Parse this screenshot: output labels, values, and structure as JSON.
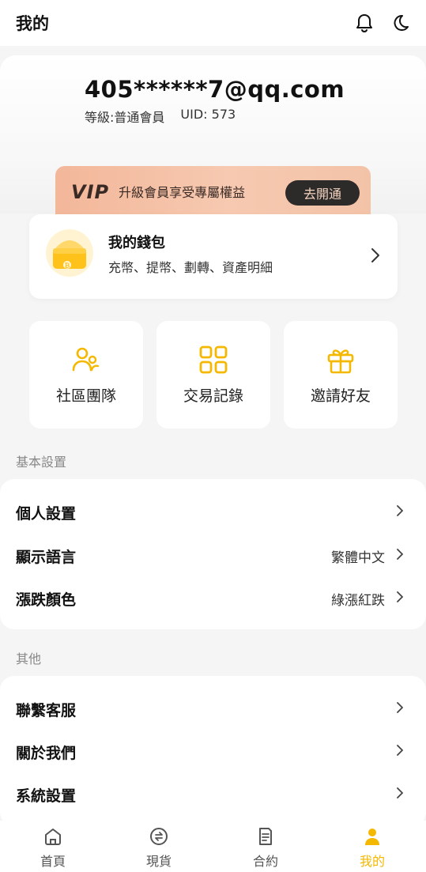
{
  "header": {
    "title": "我的",
    "icons": [
      "bell-icon",
      "moon-icon"
    ]
  },
  "profile": {
    "email": "405******7@qq.com",
    "level_label": "等級:普通會員",
    "uid": "UID: 573"
  },
  "vip": {
    "logo": "VIP",
    "text": "升級會員享受專屬權益",
    "button": "去開通"
  },
  "wallet": {
    "title": "我的錢包",
    "subtitle": "充幣、提幣、劃轉、資產明細"
  },
  "quick_actions": [
    {
      "label": "社區團隊",
      "icon": "team-icon"
    },
    {
      "label": "交易記錄",
      "icon": "grid-icon"
    },
    {
      "label": "邀請好友",
      "icon": "gift-icon"
    }
  ],
  "basic_settings": {
    "title": "基本設置",
    "rows": [
      {
        "label": "個人設置",
        "value": ""
      },
      {
        "label": "顯示語言",
        "value": "繁體中文"
      },
      {
        "label": "漲跌顏色",
        "value": "綠漲紅跌"
      }
    ]
  },
  "other": {
    "title": "其他",
    "rows": [
      {
        "label": "聯繫客服"
      },
      {
        "label": "關於我們"
      },
      {
        "label": "系統設置"
      }
    ]
  },
  "tabbar": {
    "tabs": [
      {
        "label": "首頁",
        "icon": "home-icon"
      },
      {
        "label": "現貨",
        "icon": "spot-icon"
      },
      {
        "label": "合約",
        "icon": "contract-icon"
      },
      {
        "label": "我的",
        "icon": "user-icon",
        "active": true
      }
    ]
  },
  "colors": {
    "accent": "#f5b800",
    "vip_button_bg": "#2d2a2a",
    "vip_banner": "#f3b79a"
  }
}
